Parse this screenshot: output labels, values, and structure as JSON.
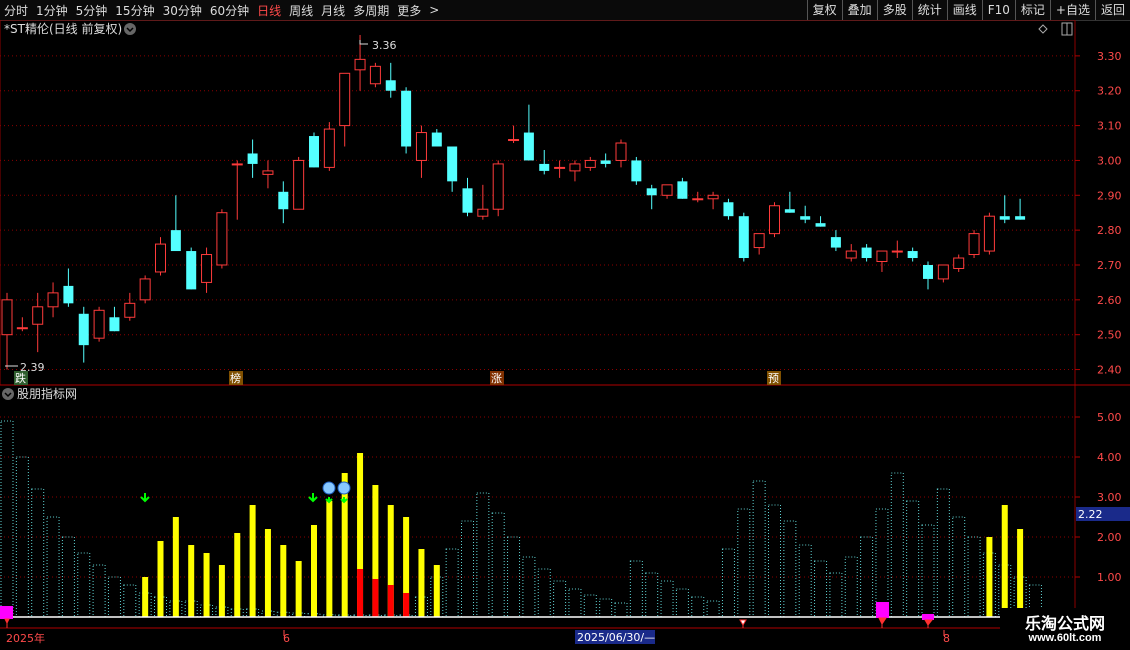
{
  "toolbar": {
    "periods": [
      "分时",
      "1分钟",
      "5分钟",
      "15分钟",
      "30分钟",
      "60分钟",
      "日线",
      "周线",
      "月线",
      "多周期",
      "更多"
    ],
    "active_period": "日线",
    "more_arrow": ">",
    "buttons": [
      "复权",
      "叠加",
      "多股",
      "统计",
      "画线",
      "F10",
      "标记",
      "+自选",
      "返回"
    ]
  },
  "main_panel": {
    "title": "*ST精伦(日线 前复权)",
    "high_label": "3.36",
    "low_label": "2.39",
    "markers": [
      "跌",
      "榜",
      "涨",
      "预"
    ],
    "price_ticks": [
      "3.30",
      "3.20",
      "3.10",
      "3.00",
      "2.90",
      "2.80",
      "2.70",
      "2.60",
      "2.50",
      "2.40"
    ]
  },
  "sub_panel": {
    "title": "股朋指标网",
    "ticks": [
      "5.00",
      "4.00",
      "3.00",
      "2.00",
      "1.00"
    ],
    "current_value": "2.22"
  },
  "date_axis": {
    "labels": [
      "2025年",
      "6",
      "8"
    ],
    "cursor_date": "2025/06/30/—"
  },
  "watermark": {
    "name": "乐淘公式网",
    "url": "www.60lt.com"
  },
  "colors": {
    "up": "#ff3b3b",
    "down": "#54ffff",
    "grid": "#8b0000",
    "yellow_bar": "#ffff00",
    "red_bar": "#ff0000",
    "marker_box": "#ff00ff"
  },
  "chart_data": {
    "type": "candlestick",
    "candles": [
      [
        2.5,
        2.62,
        2.4,
        2.6
      ],
      [
        2.52,
        2.55,
        2.51,
        2.52
      ],
      [
        2.53,
        2.62,
        2.45,
        2.58
      ],
      [
        2.58,
        2.65,
        2.55,
        2.62
      ],
      [
        2.64,
        2.69,
        2.58,
        2.59
      ],
      [
        2.56,
        2.58,
        2.42,
        2.47
      ],
      [
        2.49,
        2.58,
        2.48,
        2.57
      ],
      [
        2.55,
        2.58,
        2.51,
        2.51
      ],
      [
        2.55,
        2.62,
        2.54,
        2.59
      ],
      [
        2.6,
        2.67,
        2.59,
        2.66
      ],
      [
        2.68,
        2.78,
        2.67,
        2.76
      ],
      [
        2.8,
        2.9,
        2.78,
        2.74
      ],
      [
        2.74,
        2.75,
        2.63,
        2.63
      ],
      [
        2.65,
        2.75,
        2.62,
        2.73
      ],
      [
        2.7,
        2.86,
        2.69,
        2.85
      ],
      [
        2.99,
        3.0,
        2.83,
        2.99
      ],
      [
        3.02,
        3.06,
        2.95,
        2.99
      ],
      [
        2.96,
        3.0,
        2.92,
        2.97
      ],
      [
        2.91,
        2.94,
        2.82,
        2.86
      ],
      [
        2.86,
        3.01,
        2.86,
        3.0
      ],
      [
        3.07,
        3.08,
        2.98,
        2.98
      ],
      [
        2.98,
        3.11,
        2.97,
        3.09
      ],
      [
        3.1,
        3.22,
        3.04,
        3.25
      ],
      [
        3.26,
        3.36,
        3.2,
        3.29
      ],
      [
        3.22,
        3.28,
        3.21,
        3.27
      ],
      [
        3.23,
        3.28,
        3.18,
        3.2
      ],
      [
        3.2,
        3.21,
        3.02,
        3.04
      ],
      [
        3.0,
        3.1,
        2.95,
        3.08
      ],
      [
        3.08,
        3.09,
        3.04,
        3.04
      ],
      [
        3.04,
        3.02,
        2.91,
        2.94
      ],
      [
        2.92,
        2.95,
        2.84,
        2.85
      ],
      [
        2.84,
        2.93,
        2.83,
        2.86
      ],
      [
        2.86,
        3.0,
        2.84,
        2.99
      ],
      [
        3.06,
        3.1,
        3.05,
        3.06
      ],
      [
        3.08,
        3.16,
        3.0,
        3.0
      ],
      [
        2.99,
        3.03,
        2.96,
        2.97
      ],
      [
        2.98,
        3.0,
        2.95,
        2.98
      ],
      [
        2.97,
        3.0,
        2.94,
        2.99
      ],
      [
        2.98,
        3.01,
        2.97,
        3.0
      ],
      [
        3.0,
        3.02,
        2.98,
        2.99
      ],
      [
        3.0,
        3.06,
        2.98,
        3.05
      ],
      [
        3.0,
        3.01,
        2.93,
        2.94
      ],
      [
        2.92,
        2.93,
        2.86,
        2.9
      ],
      [
        2.9,
        2.93,
        2.89,
        2.93
      ],
      [
        2.94,
        2.95,
        2.89,
        2.89
      ],
      [
        2.89,
        2.91,
        2.88,
        2.89
      ],
      [
        2.89,
        2.91,
        2.86,
        2.9
      ],
      [
        2.88,
        2.89,
        2.83,
        2.84
      ],
      [
        2.84,
        2.85,
        2.71,
        2.72
      ],
      [
        2.75,
        2.79,
        2.73,
        2.79
      ],
      [
        2.79,
        2.88,
        2.78,
        2.87
      ],
      [
        2.86,
        2.91,
        2.85,
        2.85
      ],
      [
        2.84,
        2.87,
        2.82,
        2.83
      ],
      [
        2.82,
        2.84,
        2.81,
        2.81
      ],
      [
        2.78,
        2.8,
        2.74,
        2.75
      ],
      [
        2.72,
        2.76,
        2.71,
        2.74
      ],
      [
        2.75,
        2.76,
        2.71,
        2.72
      ],
      [
        2.71,
        2.74,
        2.68,
        2.74
      ],
      [
        2.74,
        2.77,
        2.72,
        2.74
      ],
      [
        2.74,
        2.75,
        2.71,
        2.72
      ],
      [
        2.7,
        2.71,
        2.63,
        2.66
      ],
      [
        2.66,
        2.7,
        2.65,
        2.7
      ],
      [
        2.69,
        2.73,
        2.68,
        2.72
      ],
      [
        2.73,
        2.8,
        2.72,
        2.79
      ],
      [
        2.74,
        2.85,
        2.73,
        2.84
      ],
      [
        2.84,
        2.9,
        2.82,
        2.83
      ],
      [
        2.84,
        2.89,
        2.83,
        2.83
      ]
    ],
    "price_range": [
      2.37,
      3.38
    ],
    "indicator": {
      "range": [
        0,
        5.3
      ],
      "cyan_dotted": [
        4.9,
        4.0,
        3.2,
        2.5,
        2.0,
        1.6,
        1.3,
        1.0,
        0.8,
        0.6,
        0.5,
        0.4,
        0.4,
        0.3,
        0.25,
        0.2,
        0.2,
        0.15,
        0.12,
        0.1,
        0.08,
        0.06,
        0.05,
        0.05,
        0.05,
        0.05,
        0.05,
        0.5,
        1.0,
        1.7,
        2.4,
        3.1,
        2.6,
        2.0,
        1.5,
        1.2,
        0.9,
        0.7,
        0.55,
        0.45,
        0.35,
        1.4,
        1.1,
        0.9,
        0.7,
        0.5,
        0.4,
        1.7,
        2.7,
        3.4,
        2.8,
        2.4,
        1.8,
        1.4,
        1.1,
        1.5,
        2.0,
        2.7,
        3.6,
        2.9,
        2.3,
        3.2,
        2.5,
        2.0,
        1.6,
        1.3,
        1.0,
        0.8
      ],
      "yellow_bars": [
        [
          9,
          1.0
        ],
        [
          10,
          1.9
        ],
        [
          11,
          2.5
        ],
        [
          12,
          1.8
        ],
        [
          13,
          1.6
        ],
        [
          14,
          1.3
        ],
        [
          15,
          2.1
        ],
        [
          16,
          2.8
        ],
        [
          17,
          2.2
        ],
        [
          18,
          1.8
        ],
        [
          19,
          1.4
        ],
        [
          20,
          2.3
        ],
        [
          21,
          2.9
        ],
        [
          22,
          3.6
        ],
        [
          23,
          4.1
        ],
        [
          24,
          3.3
        ],
        [
          25,
          2.8
        ],
        [
          26,
          2.5
        ],
        [
          27,
          1.7
        ],
        [
          28,
          1.3
        ],
        [
          64,
          2.0
        ],
        [
          65,
          2.8
        ],
        [
          66,
          2.2
        ]
      ],
      "red_bars": [
        [
          23,
          1.2
        ],
        [
          24,
          0.95
        ],
        [
          25,
          0.8
        ],
        [
          26,
          0.6
        ]
      ],
      "current_value": 2.22
    }
  }
}
